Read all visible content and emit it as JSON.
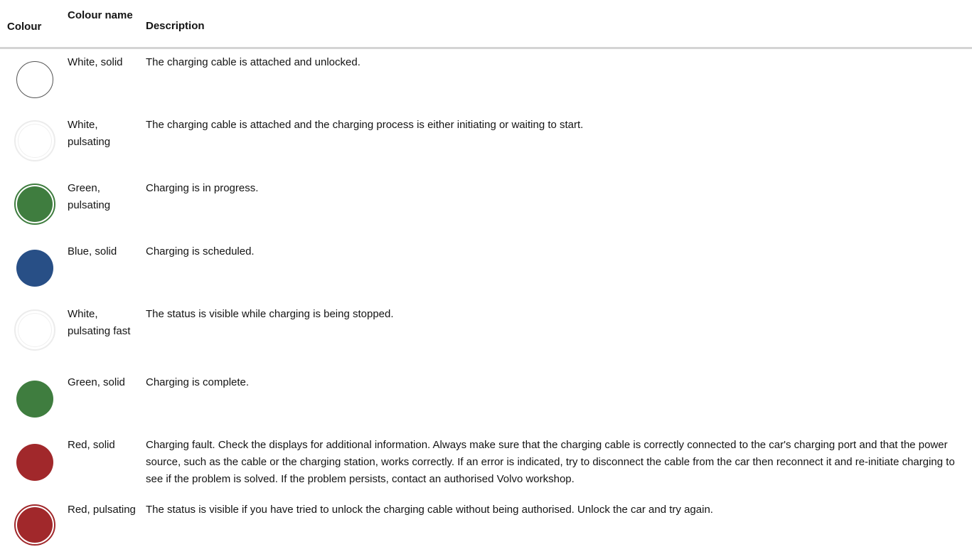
{
  "header": {
    "colour": "Colour",
    "colour_name": "Colour name",
    "description": "Description"
  },
  "rows": [
    {
      "name": "White, solid",
      "description": "The charging cable is attached and unlocked.",
      "color": "#ffffff",
      "style": "solid",
      "icon": "white-solid-circle-icon"
    },
    {
      "name": "White, pulsating",
      "description": "The charging cable is attached and the charging process is either initiating or waiting to start.",
      "color": "#ffffff",
      "style": "pulsating",
      "icon": "white-pulsating-circle-icon"
    },
    {
      "name": "Green, pulsating",
      "description": "Charging is in progress.",
      "color": "#3f7d3f",
      "style": "pulsating",
      "icon": "green-pulsating-circle-icon"
    },
    {
      "name": "Blue, solid",
      "description": "Charging is scheduled.",
      "color": "#284f86",
      "style": "solid",
      "icon": "blue-solid-circle-icon"
    },
    {
      "name": "White, pulsating fast",
      "description": "The status is visible while charging is being stopped.",
      "color": "#ffffff",
      "style": "pulsating-fast",
      "icon": "white-pulsating-fast-circle-icon"
    },
    {
      "name": "Green, solid",
      "description": "Charging is complete.",
      "color": "#3f7d3f",
      "style": "solid",
      "icon": "green-solid-circle-icon"
    },
    {
      "name": "Red, solid",
      "description": "Charging fault. Check the displays for additional information. Always make sure that the charging cable is correctly connected to the car's charging port and that the power source, such as the cable or the charging station, works correctly. If an error is indicated, try to disconnect the cable from the car then reconnect it and re-initiate charging to see if the problem is solved. If the problem persists, contact an authorised Volvo workshop.",
      "color": "#a1282b",
      "style": "solid",
      "icon": "red-solid-circle-icon"
    },
    {
      "name": "Red, pulsating",
      "description": "The status is visible if you have tried to unlock the charging cable without being authorised. Unlock the car and try again.",
      "color": "#a1282b",
      "style": "pulsating",
      "icon": "red-pulsating-circle-icon"
    }
  ]
}
